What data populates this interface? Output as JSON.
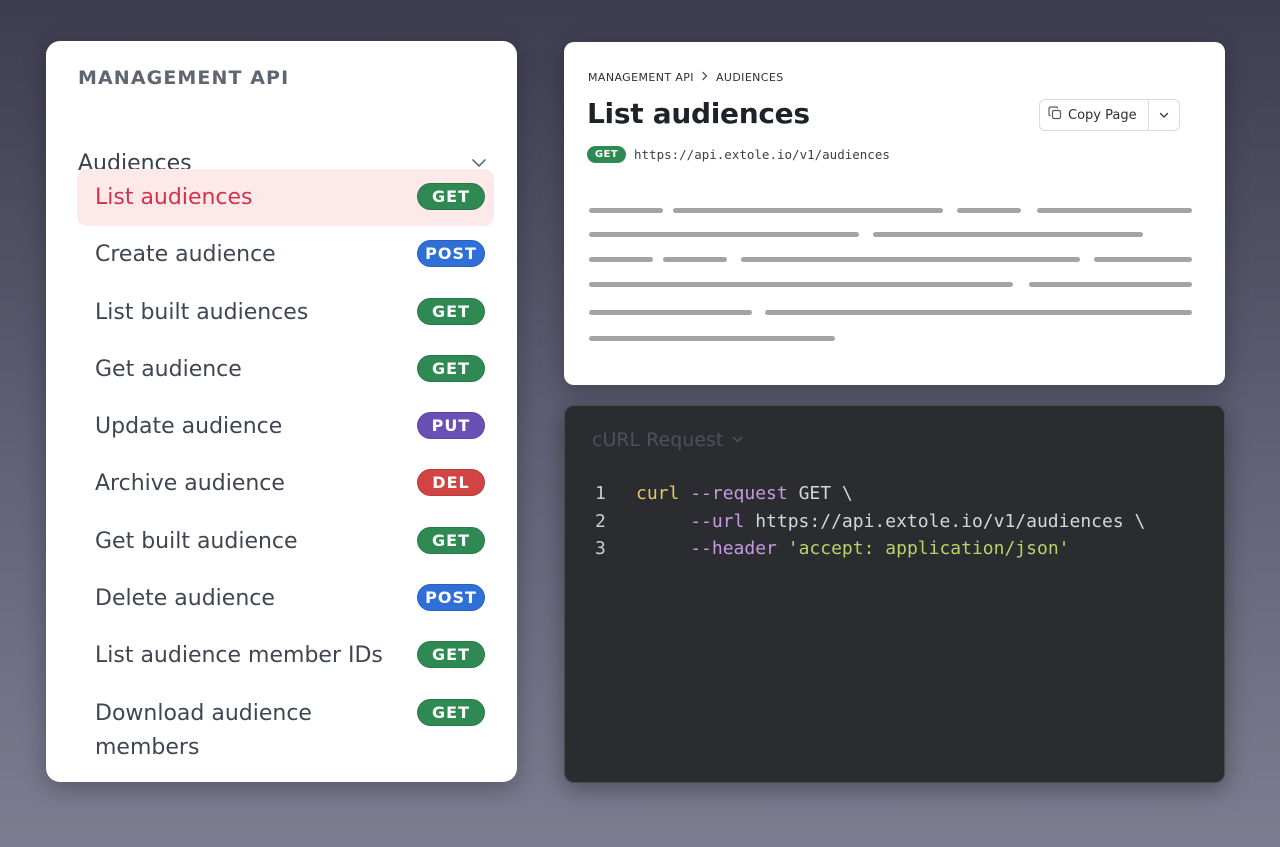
{
  "sidebar": {
    "header": "MANAGEMENT API",
    "group": {
      "label": "Audiences",
      "expanded": true
    },
    "items": [
      {
        "label": "List audiences",
        "method": "GET",
        "active": true
      },
      {
        "label": "Create audience",
        "method": "POST",
        "active": false
      },
      {
        "label": "List built audiences",
        "method": "GET",
        "active": false
      },
      {
        "label": "Get audience",
        "method": "GET",
        "active": false
      },
      {
        "label": "Update audience",
        "method": "PUT",
        "active": false
      },
      {
        "label": "Archive audience",
        "method": "DEL",
        "active": false
      },
      {
        "label": "Get built audience",
        "method": "GET",
        "active": false
      },
      {
        "label": "Delete audience",
        "method": "POST",
        "active": false
      },
      {
        "label": "List audience member IDs",
        "method": "GET",
        "active": false
      },
      {
        "label": "Download audience members",
        "method": "GET",
        "active": false
      }
    ]
  },
  "doc": {
    "breadcrumb": [
      "MANAGEMENT API",
      "AUDIENCES"
    ],
    "title": "List audiences",
    "copy_button": "Copy Page",
    "method": "GET",
    "url": "https://api.extole.io/v1/audiences"
  },
  "code": {
    "tab_label": "cURL Request",
    "lines": [
      {
        "number": "1",
        "tokens": [
          {
            "type": "cmd",
            "text": "curl "
          },
          {
            "type": "flag",
            "text": "--request"
          },
          {
            "type": "plain",
            "text": " GET \\"
          }
        ]
      },
      {
        "number": "2",
        "tokens": [
          {
            "type": "plain",
            "text": "     "
          },
          {
            "type": "flag",
            "text": "--url"
          },
          {
            "type": "plain",
            "text": " https://api.extole.io/v1/audiences \\"
          }
        ]
      },
      {
        "number": "3",
        "tokens": [
          {
            "type": "plain",
            "text": "     "
          },
          {
            "type": "flag",
            "text": "--header"
          },
          {
            "type": "plain",
            "text": " "
          },
          {
            "type": "str",
            "text": "'accept: application/json'"
          }
        ]
      }
    ]
  },
  "colors": {
    "get": "#2e8a52",
    "post": "#2f6fd8",
    "put": "#6a4fb4",
    "del": "#d24444",
    "active_text": "#d2334d",
    "active_bg": "#fde8ea"
  },
  "icons": {
    "group_toggle": "chevron-down-icon",
    "copy": "copy-icon",
    "breadcrumb_separator": "chevron-right-icon"
  }
}
